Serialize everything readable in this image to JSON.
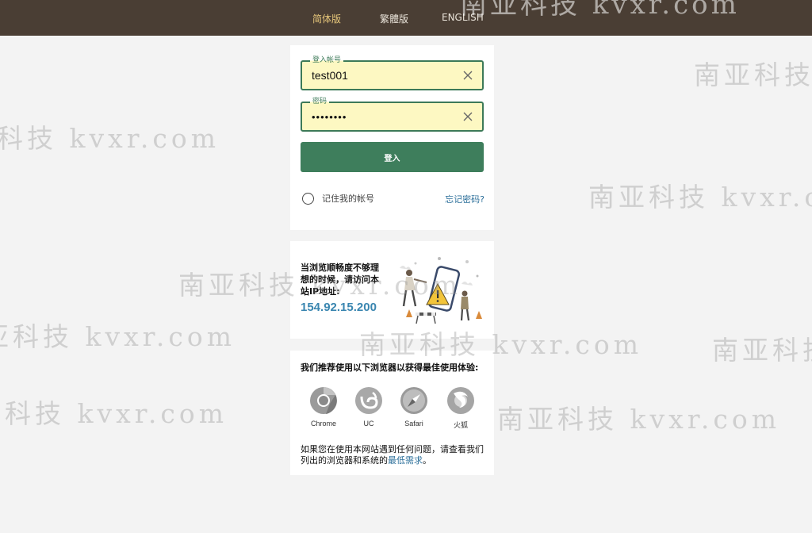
{
  "header": {
    "languages": [
      "简体版",
      "繁體版",
      "ENGLISH"
    ],
    "active_language": "简体版",
    "watermark": "南亚科技 kvxr.com"
  },
  "login": {
    "username_label": "登入帐号",
    "username_value": "test001",
    "password_label": "密码",
    "password_value": "••••••••",
    "submit_label": "登入",
    "remember_label": "记住我的帐号",
    "forgot_label": "忘记密码?"
  },
  "ip_notice": {
    "text": "当浏览顺畅度不够理想的时候，请访问本站IP地址:",
    "ip": "154.92.15.200"
  },
  "browsers": {
    "title": "我们推荐使用以下浏览器以获得最佳使用体验:",
    "items": [
      {
        "name": "Chrome",
        "icon": "chrome-icon"
      },
      {
        "name": "UC",
        "icon": "uc-browser-icon"
      },
      {
        "name": "Safari",
        "icon": "safari-icon"
      },
      {
        "name": "火狐",
        "icon": "firefox-icon"
      }
    ],
    "help_text": "如果您在使用本网站遇到任何问题，请查看我们列出的浏览器和系统的",
    "help_link": "最低需求",
    "help_end": "。"
  },
  "watermark_text": "南亚科技 kvxr.com",
  "colors": {
    "topbar": "#4a3e34",
    "accent_green": "#3e7e5c",
    "field_bg": "#fdf8c2",
    "link_blue": "#2c6f9a",
    "ip_blue": "#3a86b0"
  }
}
